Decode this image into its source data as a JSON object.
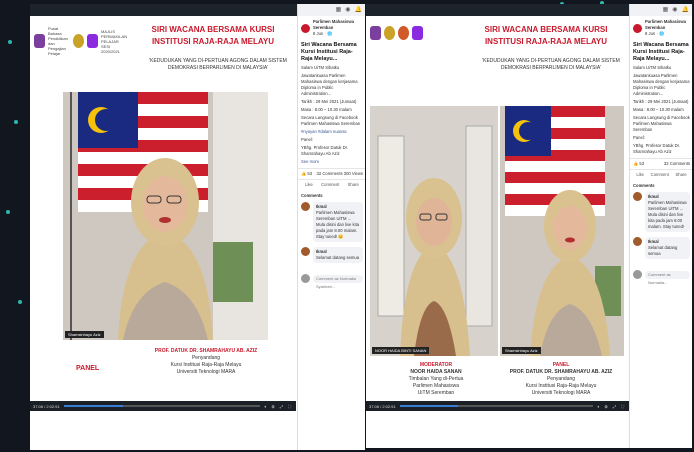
{
  "colors": {
    "background": "#12171f",
    "accent_red": "#c9192c",
    "dots": "#2fd3c8",
    "progress": "#3a7bd5"
  },
  "left": {
    "window_title": "",
    "logos": [
      {
        "text": "Pusat Bahasa Pendidikan dan Pengajian Pelajar",
        "color": "#7b3fa0"
      },
      {
        "text": "MAJLIS PERWAKILAN PELAJAR SESI 2020/2021",
        "color": "#c9a227"
      }
    ],
    "event_title": "SIRI WACANA BERSAMA KURSI INSTITUSI RAJA-RAJA MELAYU",
    "event_subtitle": "'KEDUDUKAN YANG DI-PERTUAN AGONG DALAM SISTEM DEMOKRASI BERPARLIMEN DI MALAYSIA'",
    "speaker_tag": "Shamsinhayu Aziz",
    "panel_label": "PANEL",
    "caption": {
      "name": "PROF. DATUK DR. SHAMRAHAYU AB. AZIZ",
      "lines": [
        "Penyandang",
        "Kursi Institusi Raja-Raja Melayu",
        "Universiti Teknologi MARA"
      ]
    },
    "player": {
      "time": "37:06 / 2:02:51",
      "progress": 0.3,
      "controls": "⏸ ⚙ ⤢ ⛶"
    },
    "sidebar": {
      "page_name": "Parlimen Mahasiswa Seremban",
      "page_meta": "8 Jun · 🌐",
      "post_title": "Siri Wacana Bersama Kursi Institusi Raja-Raja Melayu...",
      "lines": [
        "Salam UiTM Sihatku",
        "Jawatankuasa Parlimen Mahasiswa dengan kerjasama Diploma in Public Administration...",
        "Tarikh : 29 Mei 2021 (Jumaat)",
        "Masa : 8.00 – 10.30 malam",
        "Secara Langsung di Facebook Parlimen Mahasiswa Seremban",
        "#nyayan #dalam nuansa",
        "Panel:",
        "YBhg. Profesor Datuk Dr. Shamrahayu Ab Aziz",
        "See more"
      ],
      "reactions": "👍 53",
      "comments_count": "32 Comments 300 Views",
      "actions": [
        "Like",
        "Comment",
        "Share"
      ],
      "comments_header": "Comments",
      "comments": [
        {
          "name": "Ikmal",
          "text": "Parlimen Mahasiswa Seremban UiTM ... Mula disini dan live kita pada jam 8.00 malam. Stay tuned! 😊"
        },
        {
          "name": "Ikmal",
          "text": "Selamat datang semua"
        }
      ],
      "comment_placeholder": "Comment as Nurmalia Syahirah..."
    }
  },
  "right": {
    "window_title": "",
    "event_title": "SIRI WACANA BERSAMA KURSI INSTITUSI RAJA-RAJA MELAYU",
    "event_subtitle": "'KEDUDUKAN YANG DI-PERTUAN AGONG DALAM SISTEM DEMOKRASI BERPARLIMEN DI MALAYSIA'",
    "speaker_tag_left": "NOOR HAIDA BINTI SANAN",
    "speaker_tag_right": "Shamsinhayu Aziz",
    "moderator": {
      "role": "MODERATOR",
      "name": "NOOR HAIDA SANAN",
      "lines": [
        "Timbalan Yang di-Pertua",
        "Parlimen Mahasiswa",
        "UiTM Seremban"
      ]
    },
    "panel": {
      "role": "PANEL",
      "name": "PROF. DATUK DR. SHAMRAHAYU AB. AZIZ",
      "lines": [
        "Penyandang",
        "Kursi Institusi Raja-Raja Melayu",
        "Universiti Teknologi MARA"
      ]
    },
    "player": {
      "time": "37:06 / 2:02:51",
      "progress": 0.3,
      "controls": "⏸ ⚙ ⤢ ⛶"
    },
    "sidebar": {
      "page_name": "Parlimen Mahasiswa Seremban",
      "page_meta": "8 Jun · 🌐",
      "post_title": "Siri Wacana Bersama Kursi Institusi Raja-Raja Melayu...",
      "lines": [
        "Salam UiTM Sihatku",
        "Jawatankuasa Parlimen Mahasiswa dengan kerjasama Diploma in Public Administration...",
        "Tarikh : 29 Mei 2021 (Jumaat)",
        "Masa : 8.00 – 10.30 malam",
        "Secara Langsung di Facebook Parlimen Mahasiswa Seremban",
        "Panel:",
        "YBhg. Profesor Datuk Dr. Shamrahayu Ab Aziz"
      ],
      "reactions": "👍 53",
      "comments_count": "32 Comments",
      "actions": [
        "Like",
        "Comment",
        "Share"
      ],
      "comments_header": "Comments",
      "comments": [
        {
          "name": "Ikmal",
          "text": "Parlimen Mahasiswa Seremban UiTM ... Mula disini dan live kita pada jam 8.00 malam. Stay tuned!"
        },
        {
          "name": "Ikmal",
          "text": "Selamat datang semua"
        }
      ],
      "comment_placeholder": "Comment as Nurmalia..."
    }
  }
}
